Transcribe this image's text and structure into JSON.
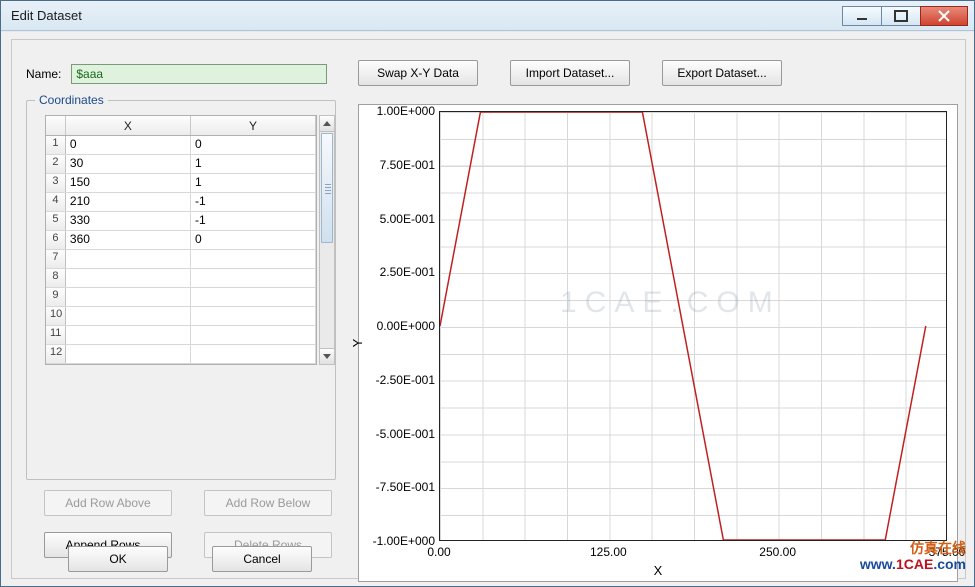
{
  "window": {
    "title": "Edit Dataset"
  },
  "name": {
    "label": "Name:",
    "value": "$aaa"
  },
  "topButtons": {
    "swap": "Swap X-Y Data",
    "import": "Import Dataset...",
    "export": "Export Dataset..."
  },
  "coordinates": {
    "title": "Coordinates",
    "headers": {
      "x": "X",
      "y": "Y"
    },
    "rows": [
      {
        "n": "1",
        "x": "0",
        "y": "0"
      },
      {
        "n": "2",
        "x": "30",
        "y": "1"
      },
      {
        "n": "3",
        "x": "150",
        "y": "1"
      },
      {
        "n": "4",
        "x": "210",
        "y": "-1"
      },
      {
        "n": "5",
        "x": "330",
        "y": "-1"
      },
      {
        "n": "6",
        "x": "360",
        "y": "0"
      },
      {
        "n": "7",
        "x": "",
        "y": ""
      },
      {
        "n": "8",
        "x": "",
        "y": ""
      },
      {
        "n": "9",
        "x": "",
        "y": ""
      },
      {
        "n": "10",
        "x": "",
        "y": ""
      },
      {
        "n": "11",
        "x": "",
        "y": ""
      },
      {
        "n": "12",
        "x": "",
        "y": ""
      }
    ]
  },
  "rowButtons": {
    "addAbove": "Add Row Above",
    "addBelow": "Add Row Below",
    "append": "Append Rows...",
    "delete": "Delete Rows"
  },
  "dialogButtons": {
    "ok": "OK",
    "cancel": "Cancel"
  },
  "chart": {
    "yTicks": [
      "1.00E+000",
      "7.50E-001",
      "5.00E-001",
      "2.50E-001",
      "0.00E+000",
      "-2.50E-001",
      "-5.00E-001",
      "-7.50E-001",
      "-1.00E+000"
    ],
    "xTicks": [
      "0.00",
      "125.00",
      "250.00",
      "375.00"
    ],
    "xlabel": "X",
    "ylabel": "Y"
  },
  "chart_data": {
    "type": "line",
    "x": [
      0,
      30,
      150,
      210,
      330,
      360
    ],
    "y": [
      0,
      1,
      1,
      -1,
      -1,
      0
    ],
    "xlabel": "X",
    "ylabel": "Y",
    "xlim": [
      0,
      375
    ],
    "ylim": [
      -1,
      1
    ],
    "series_color": "#c02020"
  },
  "watermark": {
    "line1": "仿真在线",
    "line2a": "www.",
    "line2b": "1CAE",
    "line2c": ".com"
  },
  "centermark": "1CAE.COM"
}
